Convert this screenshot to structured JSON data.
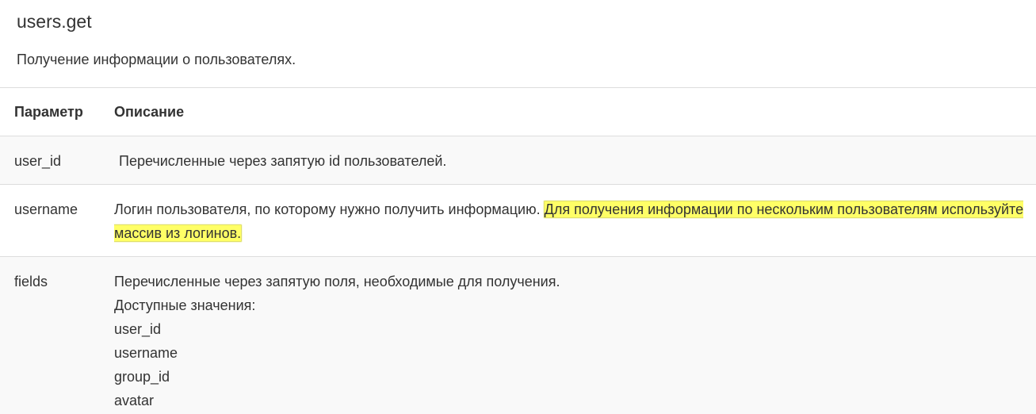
{
  "method": {
    "title": "users.get",
    "description": "Получение информации о пользователях."
  },
  "table": {
    "headers": {
      "param": "Параметр",
      "description": "Описание"
    },
    "rows": [
      {
        "param": "user_id",
        "description": "Перечисленные через запятую id пользователей."
      },
      {
        "param": "username",
        "description_plain": "Логин пользователя, по которому нужно получить информацию.",
        "description_highlighted": "Для получения информации по нескольким пользователям используйте массив из логинов."
      },
      {
        "param": "fields",
        "description": "Перечисленные через запятую поля, необходимые для получения.",
        "values_label": "Доступные значения:",
        "values": [
          "user_id",
          "username",
          "group_id",
          "avatar"
        ]
      }
    ]
  },
  "colors": {
    "highlight": "#ffff66",
    "row_stripe": "#f9f9f9",
    "border": "#dddddd",
    "text": "#333333"
  }
}
